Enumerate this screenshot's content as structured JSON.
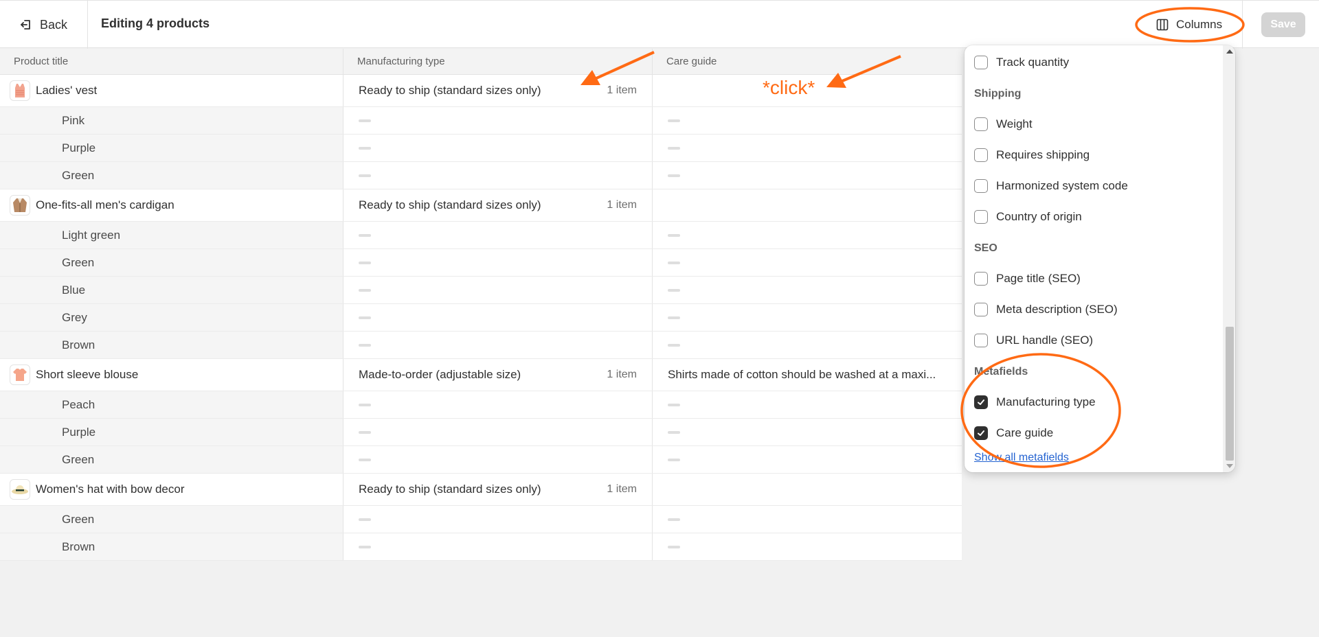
{
  "topbar": {
    "back_label": "Back",
    "title": "Editing 4 products",
    "columns_label": "Columns",
    "save_label": "Save"
  },
  "table": {
    "headers": [
      "Product title",
      "Manufacturing type",
      "Care guide"
    ],
    "products": [
      {
        "title": "Ladies' vest",
        "thumb_icon": "vest-icon",
        "manufacturing_type": "Ready to ship (standard sizes only)",
        "count": "1 item",
        "care_guide": "",
        "variants": [
          "Pink",
          "Purple",
          "Green"
        ]
      },
      {
        "title": "One-fits-all men's cardigan",
        "thumb_icon": "cardigan-icon",
        "manufacturing_type": "Ready to ship (standard sizes only)",
        "count": "1 item",
        "care_guide": "",
        "variants": [
          "Light green",
          "Green",
          "Blue",
          "Grey",
          "Brown"
        ]
      },
      {
        "title": "Short sleeve blouse",
        "thumb_icon": "blouse-icon",
        "manufacturing_type": "Made-to-order (adjustable size)",
        "count": "1 item",
        "care_guide": "Shirts made of cotton should be washed at a maxi...",
        "variants": [
          "Peach",
          "Purple",
          "Green"
        ]
      },
      {
        "title": "Women's hat with bow decor",
        "thumb_icon": "hat-icon",
        "manufacturing_type": "Ready to ship (standard sizes only)",
        "count": "1 item",
        "care_guide": "",
        "variants": [
          "Green",
          "Brown"
        ]
      }
    ]
  },
  "columns_popover": {
    "options": [
      {
        "label": "Track quantity",
        "checked": false
      },
      {
        "section": "Shipping"
      },
      {
        "label": "Weight",
        "checked": false
      },
      {
        "label": "Requires shipping",
        "checked": false
      },
      {
        "label": "Harmonized system code",
        "checked": false
      },
      {
        "label": "Country of origin",
        "checked": false
      },
      {
        "section": "SEO"
      },
      {
        "label": "Page title (SEO)",
        "checked": false
      },
      {
        "label": "Meta description (SEO)",
        "checked": false
      },
      {
        "label": "URL handle (SEO)",
        "checked": false
      },
      {
        "section": "Metafields"
      },
      {
        "label": "Manufacturing type",
        "checked": true
      },
      {
        "label": "Care guide",
        "checked": true
      }
    ],
    "show_all_label": "Show all metafields"
  },
  "annotations": {
    "click_label": "*click*",
    "color": "#ff6a14"
  }
}
